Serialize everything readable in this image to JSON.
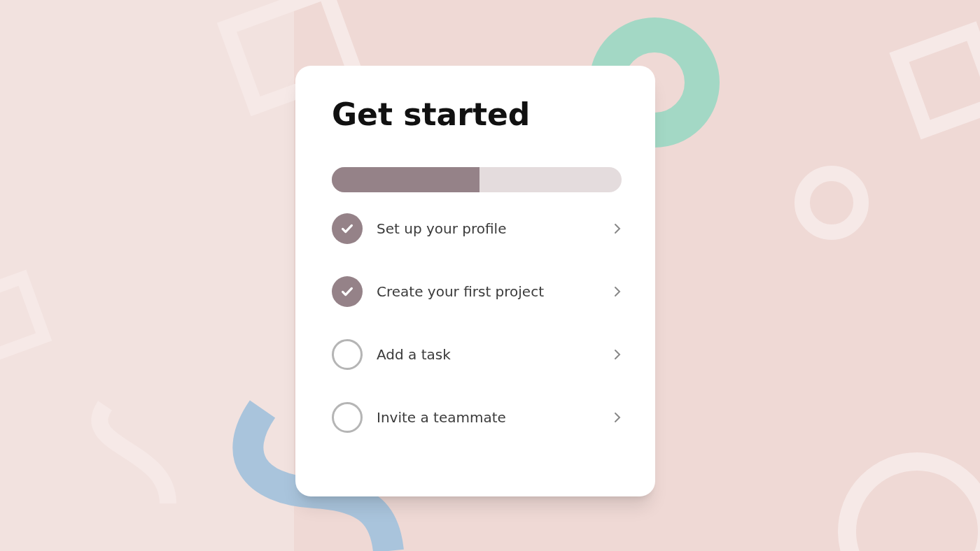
{
  "card": {
    "title": "Get started",
    "progress": {
      "level": 0.51
    },
    "tasks": [
      {
        "label": "Set up your profile",
        "checked": true
      },
      {
        "label": "Create your first project",
        "checked": true
      },
      {
        "label": "Add a task",
        "checked": false
      },
      {
        "label": "Invite a teammate",
        "checked": false
      }
    ]
  }
}
